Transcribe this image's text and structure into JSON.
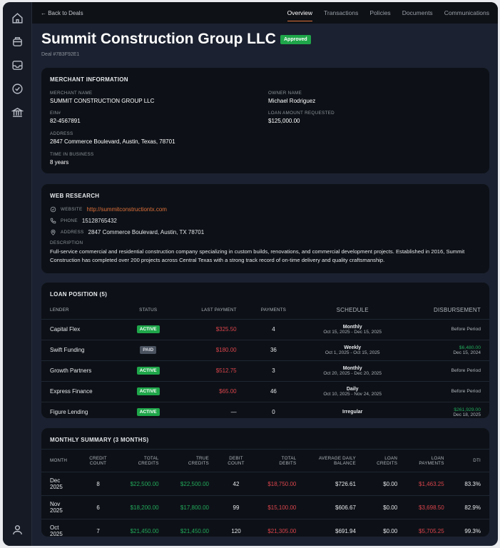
{
  "nav": {
    "back": "← Back to Deals",
    "tabs": [
      "Overview",
      "Transactions",
      "Policies",
      "Documents",
      "Communications"
    ],
    "active_tab": "Overview"
  },
  "header": {
    "title": "Summit Construction Group LLC",
    "status": "Approved",
    "deal": "Deal #7B3F92E1"
  },
  "merchant": {
    "title": "MERCHANT INFORMATION",
    "merchant_name_label": "MERCHANT NAME",
    "merchant_name": "SUMMIT CONSTRUCTION GROUP LLC",
    "owner_label": "OWNER NAME",
    "owner": "Michael Rodriguez",
    "ein_label": "EIN#",
    "ein": "82-4567891",
    "loan_label": "LOAN AMOUNT REQUESTED",
    "loan": "$125,000.00",
    "address_label": "ADDRESS",
    "address": "2847 Commerce Boulevard, Austin, Texas, 78701",
    "tib_label": "TIME IN BUSINESS",
    "tib": "8 years"
  },
  "web": {
    "title": "WEB RESEARCH",
    "website_label": "WEBSITE",
    "website": "http://summitconstructiontx.com",
    "phone_label": "PHONE",
    "phone": "15128765432",
    "address_label": "ADDRESS",
    "address": "2847 Commerce Boulevard, Austin, TX 78701",
    "description_label": "DESCRIPTION",
    "description": "Full-service commercial and residential construction company specializing in custom builds, renovations, and commercial development projects. Established in 2016, Summit Construction has completed over 200 projects across Central Texas with a strong track record of on-time delivery and quality craftsmanship."
  },
  "loans": {
    "title": "LOAN POSITION (5)",
    "headers": [
      "LENDER",
      "STATUS",
      "LAST PAYMENT",
      "PAYMENTS",
      "SCHEDULE",
      "DISBURSEMENT"
    ],
    "rows": [
      {
        "lender": "Capital Flex",
        "status": "ACTIVE",
        "last": "$325.50",
        "payments": "4",
        "freq": "Monthly",
        "range": "Oct 15, 2025 - Dec 15, 2025",
        "disb": "Before Period",
        "disb_date": ""
      },
      {
        "lender": "Swift Funding",
        "status": "PAID",
        "last": "$180.00",
        "payments": "36",
        "freq": "Weekly",
        "range": "Oct 1, 2025 - Oct 15, 2025",
        "disb": "$6,480.00",
        "disb_date": "Dec 15, 2024"
      },
      {
        "lender": "Growth Partners",
        "status": "ACTIVE",
        "last": "$512.75",
        "payments": "3",
        "freq": "Monthly",
        "range": "Oct 20, 2025 - Dec 20, 2025",
        "disb": "Before Period",
        "disb_date": ""
      },
      {
        "lender": "Express Finance",
        "status": "ACTIVE",
        "last": "$65.00",
        "payments": "46",
        "freq": "Daily",
        "range": "Oct 10, 2025 - Nov 24, 2025",
        "disb": "Before Period",
        "disb_date": ""
      },
      {
        "lender": "Figure Lending",
        "status": "ACTIVE",
        "last": "—",
        "payments": "0",
        "freq": "Irregular",
        "range": "",
        "disb": "$261,929.00",
        "disb_date": "Dec 18, 2025"
      }
    ]
  },
  "summary": {
    "title": "MONTHLY SUMMARY (3 MONTHS)",
    "headers": [
      [
        "MONTH",
        ""
      ],
      [
        "CREDIT",
        "COUNT"
      ],
      [
        "TOTAL",
        "CREDITS"
      ],
      [
        "TRUE",
        "CREDITS"
      ],
      [
        "DEBIT",
        "COUNT"
      ],
      [
        "TOTAL",
        "DEBITS"
      ],
      [
        "AVERAGE DAILY",
        "BALANCE"
      ],
      [
        "LOAN",
        "CREDITS"
      ],
      [
        "LOAN",
        "PAYMENTS"
      ],
      [
        "DTI",
        ""
      ]
    ],
    "rows": [
      {
        "m1": "Dec",
        "m2": "2025",
        "cc": "8",
        "tc": "$22,500.00",
        "tr": "$22,500.00",
        "dc": "42",
        "td": "$18,750.00",
        "adb": "$726.61",
        "lc": "$0.00",
        "lp": "$1,463.25",
        "dti": "83.3%"
      },
      {
        "m1": "Nov",
        "m2": "2025",
        "cc": "6",
        "tc": "$18,200.00",
        "tr": "$17,800.00",
        "dc": "99",
        "td": "$15,100.00",
        "adb": "$606.67",
        "lc": "$0.00",
        "lp": "$3,698.50",
        "dti": "82.9%"
      },
      {
        "m1": "Oct",
        "m2": "2025",
        "cc": "7",
        "tc": "$21,450.00",
        "tr": "$21,450.00",
        "dc": "120",
        "td": "$21,305.00",
        "adb": "$691.94",
        "lc": "$0.00",
        "lp": "$5,705.25",
        "dti": "99.3%"
      }
    ]
  },
  "colors": {
    "accent": "#e0703a",
    "success": "#1fa64a",
    "danger": "#d9434b"
  }
}
